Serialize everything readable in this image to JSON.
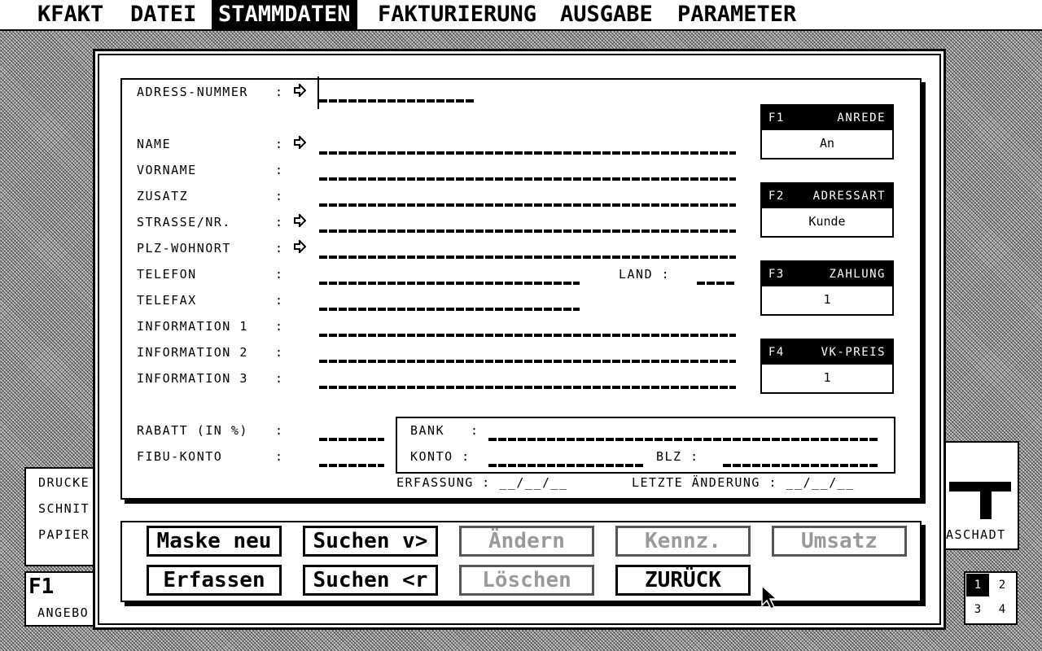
{
  "menu": [
    "KFAKT",
    "DATEI",
    "STAMMDATEN",
    "FAKTURIERUNG",
    "AUSGABE",
    "PARAMETER"
  ],
  "background_panels": {
    "left_items": [
      "DRUCKE",
      "SCHNIT",
      "PAPIER"
    ],
    "f1_title": "F1",
    "f1_label": "ANGEBO",
    "right_text": "ASCHADT"
  },
  "screens": [
    "1",
    "2",
    "3",
    "4"
  ],
  "form": {
    "labels": {
      "adress_nummer": "ADRESS-NUMMER",
      "name": "NAME",
      "vorname": "VORNAME",
      "zusatz": "ZUSATZ",
      "strasse": "STRASSE/NR.",
      "plz": "PLZ-WOHNORT",
      "telefon": "TELEFON",
      "telefax": "TELEFAX",
      "info1": "INFORMATION 1",
      "info2": "INFORMATION 2",
      "info3": "INFORMATION 3",
      "land": "LAND :",
      "rabatt": "RABATT (IN %)",
      "fibu": "FIBU-KONTO",
      "bank": "BANK",
      "konto": "KONTO :",
      "blz": "BLZ :",
      "erfassung": "ERFASSUNG : __/__/__",
      "letzte": "LETZTE ÄNDERUNG : __/__/__"
    },
    "colon": ":"
  },
  "fkeys": [
    {
      "key": "F1",
      "title": "ANREDE",
      "value": "An"
    },
    {
      "key": "F2",
      "title": "ADRESSART",
      "value": "Kunde"
    },
    {
      "key": "F3",
      "title": "ZAHLUNG",
      "value": "1"
    },
    {
      "key": "F4",
      "title": "VK-PREIS",
      "value": "1"
    }
  ],
  "buttons": {
    "maske_neu": "Maske neu",
    "suchen_vor": "Suchen v>",
    "aendern": "Ändern",
    "kennz": "Kennz.",
    "umsatz": "Umsatz",
    "erfassen": "Erfassen",
    "suchen_zurueck": "Suchen <r",
    "loeschen": "Löschen",
    "zurueck": "ZURÜCK"
  }
}
